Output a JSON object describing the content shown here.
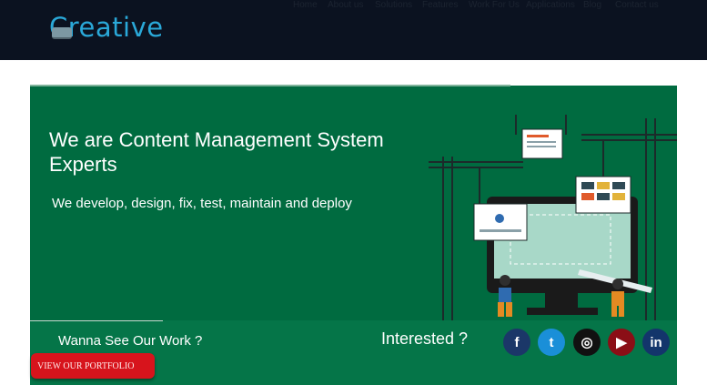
{
  "header": {
    "logo_text": "Creative",
    "nav": [
      {
        "label": "Home"
      },
      {
        "label": "About us"
      },
      {
        "label": "Solutions"
      },
      {
        "label": "Features"
      },
      {
        "label": "Work For Us"
      },
      {
        "label": "Applications"
      },
      {
        "label": "Blog"
      },
      {
        "label": "Contact us"
      }
    ]
  },
  "hero": {
    "title": "We are Content Management System Experts",
    "subtitle": "We develop, design, fix, test, maintain and deploy"
  },
  "band": {
    "work_label": "Wanna See Our Work ?",
    "portfolio_button": "VIEW OUR PORTFOLIO",
    "interested_label": "Interested ?",
    "social": [
      {
        "icon": "facebook-icon",
        "glyph": "f",
        "color": "#1b3768"
      },
      {
        "icon": "twitter-icon",
        "glyph": "t",
        "color": "#1a8fd8"
      },
      {
        "icon": "instagram-icon",
        "glyph": "◎",
        "color": "#111111"
      },
      {
        "icon": "youtube-icon",
        "glyph": "▶",
        "color": "#8b0e16"
      },
      {
        "icon": "linkedin-icon",
        "glyph": "in",
        "color": "#13356b"
      }
    ]
  },
  "colors": {
    "topbar": "#0b1220",
    "hero": "#006b40",
    "band": "#057548",
    "button": "#d7141c",
    "logo": "#2aa8d8"
  }
}
